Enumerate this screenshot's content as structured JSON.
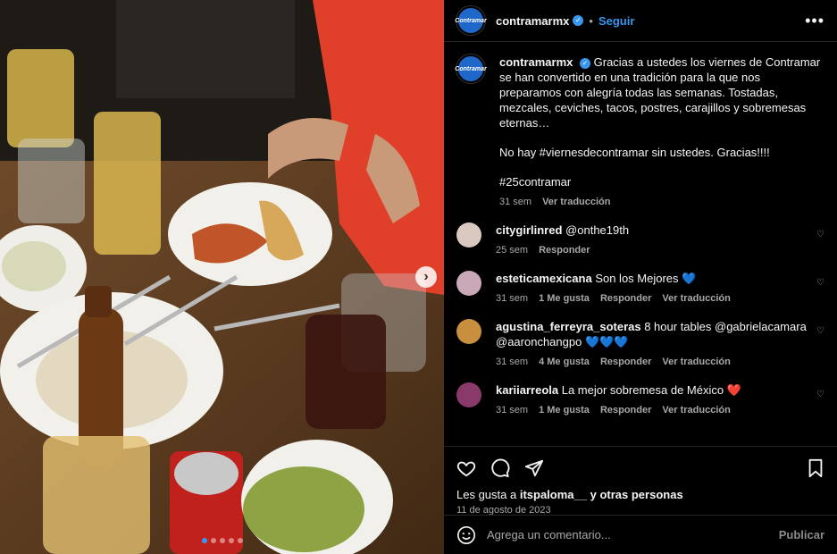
{
  "post": {
    "username": "contramarmx",
    "avatar_text": "Contramar",
    "follow_label": "Seguir",
    "more_label": "•••",
    "caption": {
      "username": "contramarmx",
      "text1": "Gracias a ustedes los viernes de Contramar se han convertido en una tradición para la que nos preparamos con alegría todas las semanas. Tostadas, mezcales, ceviches, tacos, postres, carajillos y sobremesas eternas…",
      "text2": "No hay #viernesdecontramar sin ustedes. Gracias!!!!",
      "text3": "#25contramar",
      "time": "31 sem",
      "translate": "Ver traducción"
    },
    "comments": [
      {
        "user": "citygirlinred",
        "text": "@onthe19th",
        "time": "25 sem",
        "likes": "",
        "reply": "Responder",
        "translate": "",
        "avatar_color": "#d9c9c0"
      },
      {
        "user": "esteticamexicana",
        "text": "Son los Mejores 💙",
        "time": "31 sem",
        "likes": "1 Me gusta",
        "reply": "Responder",
        "translate": "Ver traducción",
        "avatar_color": "#c9a8b8"
      },
      {
        "user": "agustina_ferreyra_soteras",
        "text": "8 hour tables @gabrielacamara @aaronchangpo 💙💙💙",
        "time": "31 sem",
        "likes": "4 Me gusta",
        "reply": "Responder",
        "translate": "Ver traducción",
        "avatar_color": "#c88f3e"
      },
      {
        "user": "kariiarreola",
        "text": "La mejor sobremesa de México ❤️",
        "time": "31 sem",
        "likes": "1 Me gusta",
        "reply": "Responder",
        "translate": "Ver traducción",
        "avatar_color": "#8a3a6a"
      }
    ],
    "likes_prefix": "Les gusta a",
    "likes_user": "itspaloma__",
    "likes_suffix": "y otras personas",
    "date": "11 de agosto de 2023",
    "comment_placeholder": "Agrega un comentario...",
    "publish_label": "Publicar"
  },
  "carousel": {
    "dot_count": 5,
    "active_index": 0
  },
  "colors": {
    "accent": "#3897f0",
    "brand": "#1f67c9"
  }
}
